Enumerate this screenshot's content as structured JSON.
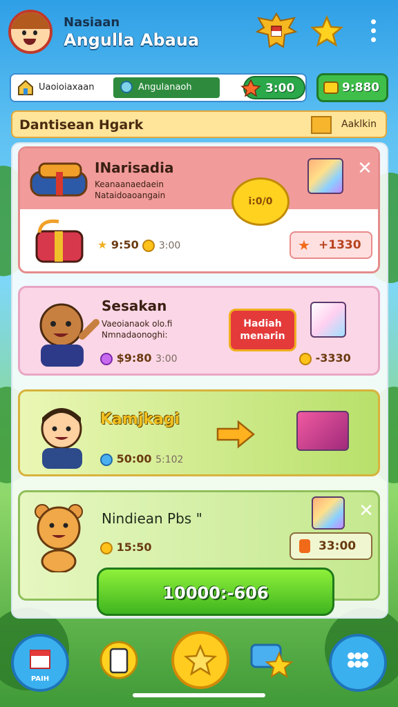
{
  "header": {
    "title_small": "Nasiaan",
    "title_large": "Angulla Abaua"
  },
  "tabs": {
    "tab1_label": "Uaoioiaxaan",
    "tab2_label": "Angulanaoh"
  },
  "currency": {
    "coins": "3:00",
    "gems": "9:880"
  },
  "quest_bar": {
    "label": "Dantisean Hgark",
    "action": "Aaklkin"
  },
  "cards": [
    {
      "title": "INarisadia",
      "desc_line1": "Keanaanaedaein",
      "desc_line2": "Nataidoaoangain",
      "badge": "i:0/0",
      "price": "9:50",
      "price_muted": "3:00",
      "reward": "+1330"
    },
    {
      "title": "Sesakan",
      "desc_line1": "Vaeoianaok olo.fi",
      "desc_line2": "Nmnadaonoghi:",
      "badge_line1": "Hadiah",
      "badge_line2": "menarin",
      "price": "$9:80",
      "price_muted": "3:00",
      "reward": "-3330"
    },
    {
      "title": "Kamjkagi",
      "price": "50:00",
      "price_muted": "5:102"
    },
    {
      "title": "Nindiean Pbs \"",
      "price": "15:50",
      "reward": "33:00"
    }
  ],
  "main_button": {
    "label": "10000:-606"
  },
  "bottom_nav": {
    "home_label": "PAIH"
  },
  "colors": {
    "sky": "#2f9fe6",
    "primary_green": "#3fb51f",
    "gold": "#ffcc1f",
    "card1_header": "#f19b9b",
    "card2_bg": "#fbd6e6"
  },
  "icons": [
    "home-icon",
    "star-icon",
    "menu-dots-icon",
    "coin-icon",
    "gem-icon",
    "chest-icon",
    "close-icon",
    "gift-box-icon",
    "arrow-right-icon",
    "phone-icon",
    "chat-star-icon",
    "grid-icon"
  ]
}
